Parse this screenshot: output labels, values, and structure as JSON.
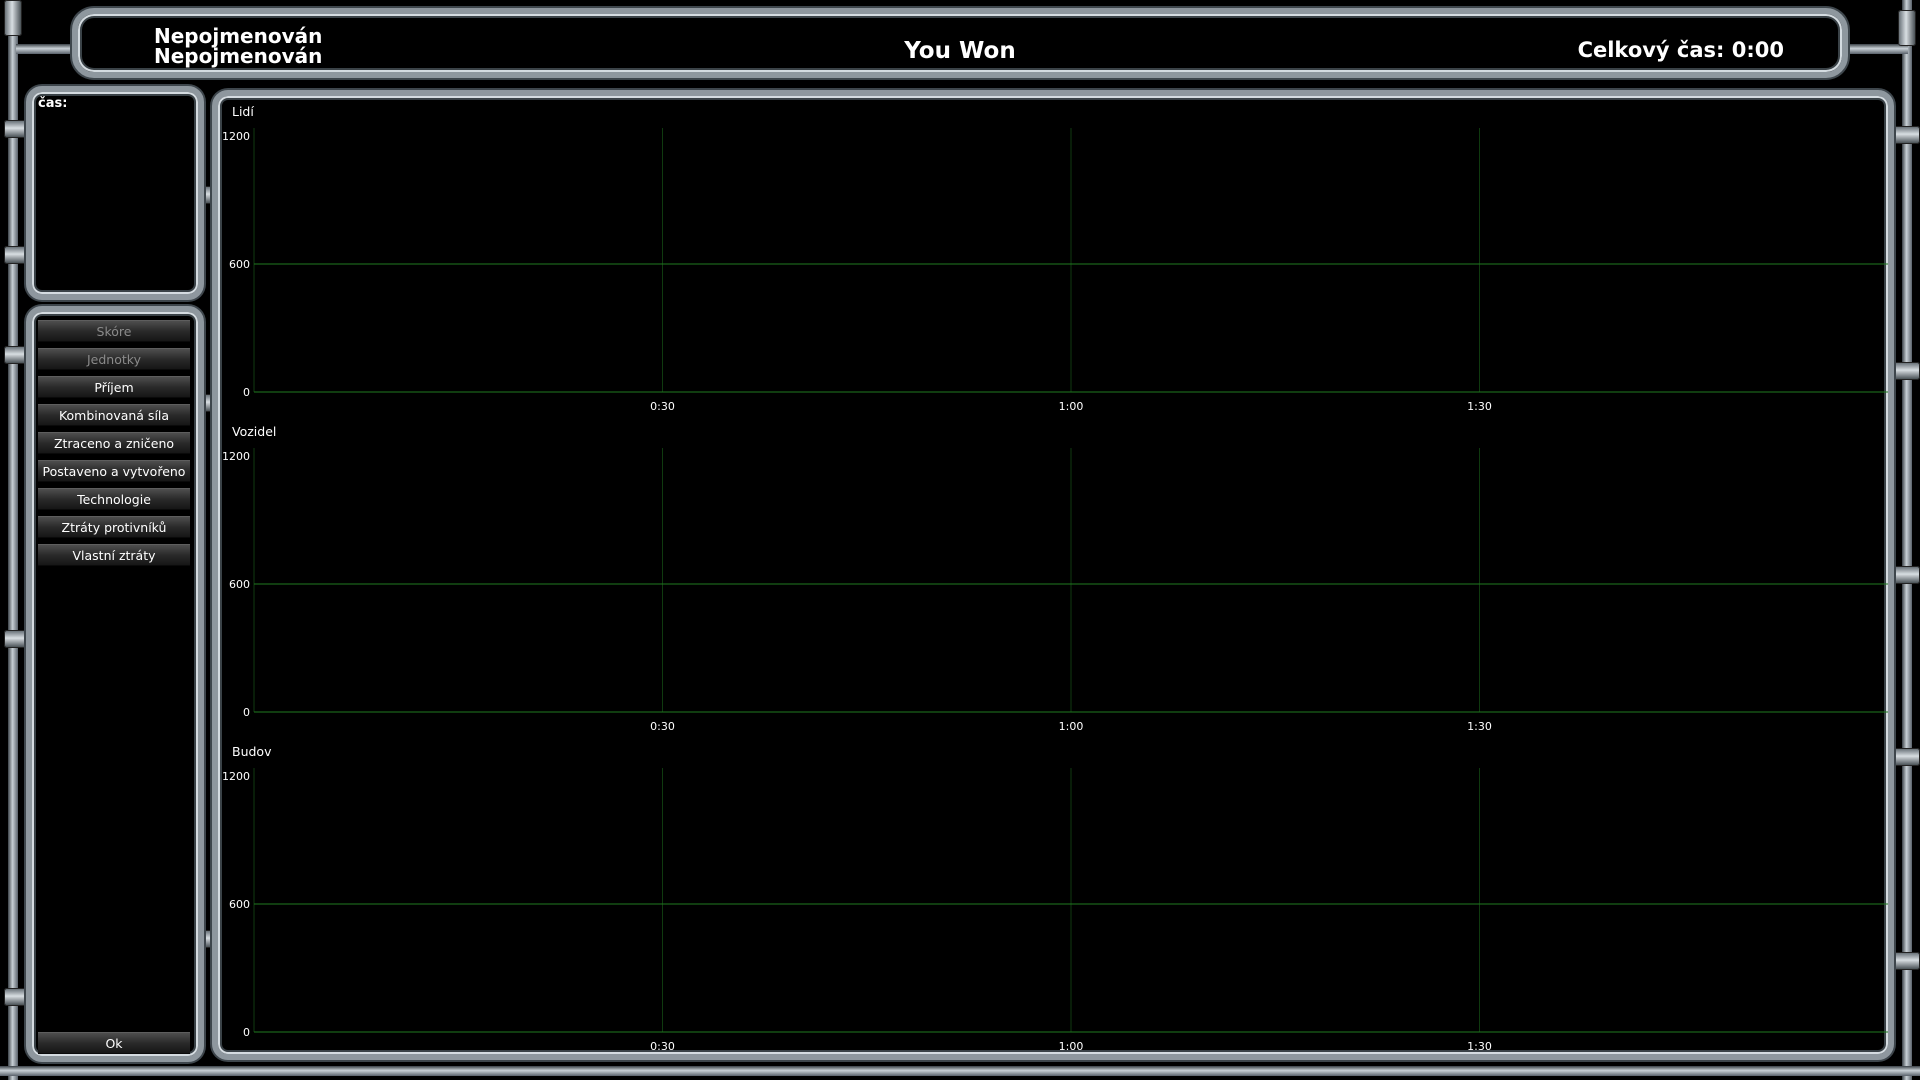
{
  "header": {
    "player_1": "Nepojmenován",
    "player_2": "Nepojmenován",
    "title": "You Won",
    "total_time": "Celkový čas: 0:00"
  },
  "time_panel": {
    "label": "čas:"
  },
  "menu": {
    "items": [
      {
        "label": "Skóre",
        "enabled": false
      },
      {
        "label": "Jednotky",
        "enabled": false
      },
      {
        "label": "Příjem",
        "enabled": true
      },
      {
        "label": "Kombinovaná síla",
        "enabled": true
      },
      {
        "label": "Ztraceno a zničeno",
        "enabled": true
      },
      {
        "label": "Postaveno a vytvořeno",
        "enabled": true
      },
      {
        "label": "Technologie",
        "enabled": true
      },
      {
        "label": "Ztráty protivníků",
        "enabled": true
      },
      {
        "label": "Vlastní ztráty",
        "enabled": true
      }
    ],
    "ok_label": "Ok"
  },
  "colors": {
    "grid_major": "#1f7a1f",
    "grid_minor": "#0f3a0f",
    "axis_label": "#ffffff",
    "disabled_text": "#8a8a8a"
  },
  "chart_data": [
    {
      "type": "line",
      "title": "Lidí",
      "x_ticks": [
        "0:30",
        "1:00",
        "1:30"
      ],
      "y_ticks": [
        0,
        600,
        1200
      ],
      "ylim": [
        0,
        1200
      ],
      "series": []
    },
    {
      "type": "line",
      "title": "Vozidel",
      "x_ticks": [
        "0:30",
        "1:00",
        "1:30"
      ],
      "y_ticks": [
        0,
        600,
        1200
      ],
      "ylim": [
        0,
        1200
      ],
      "series": []
    },
    {
      "type": "line",
      "title": "Budov",
      "x_ticks": [
        "0:30",
        "1:00",
        "1:30"
      ],
      "y_ticks": [
        0,
        600,
        1200
      ],
      "ylim": [
        0,
        1200
      ],
      "series": []
    }
  ]
}
